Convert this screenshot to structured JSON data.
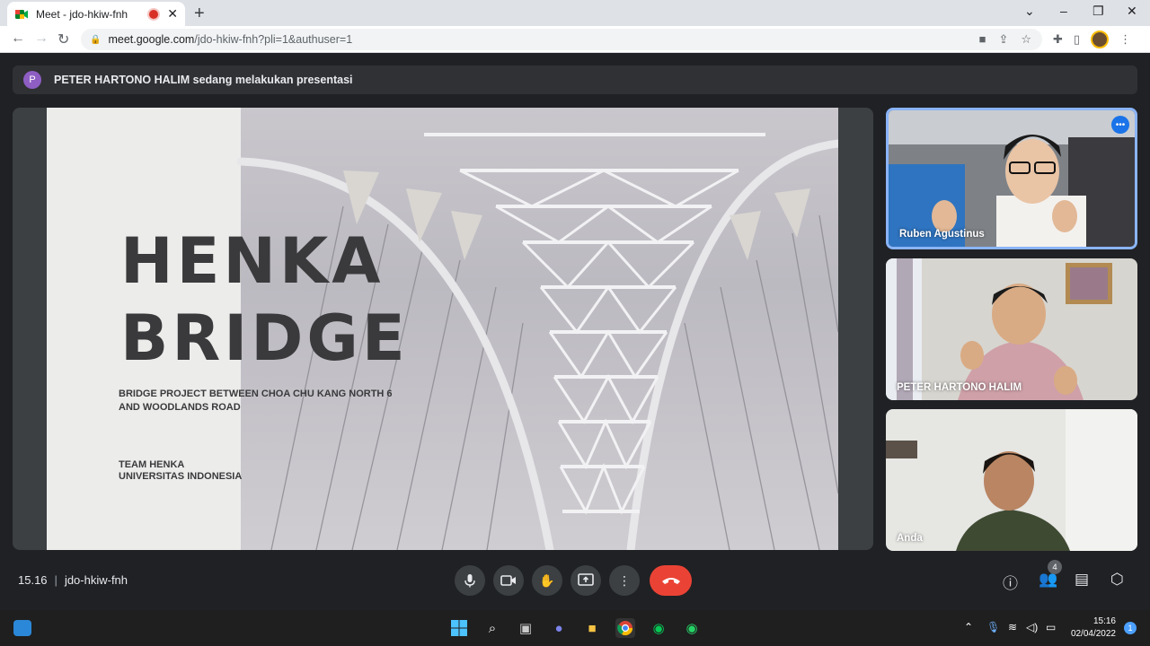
{
  "browser": {
    "tab_title": "Meet - jdo-hkiw-fnh",
    "tab_close": "✕",
    "new_tab": "+",
    "url_host": "meet.google.com",
    "url_path": "/jdo-hkiw-fnh?pli=1&authuser=1",
    "window_controls": [
      "⌄",
      "–",
      "❐",
      "✕"
    ]
  },
  "banner": {
    "avatar_letter": "P",
    "text": "PETER HARTONO HALIM sedang melakukan presentasi"
  },
  "slide": {
    "title_line1": "HENKA",
    "title_line2": "BRIDGE",
    "subtitle_line1": "BRIDGE PROJECT BETWEEN CHOA CHU KANG NORTH 6",
    "subtitle_line2": "AND WOODLANDS ROAD",
    "team_line1": "TEAM HENKA",
    "team_line2": "UNIVERSITAS INDONESIA"
  },
  "participants": [
    {
      "name": "Ruben Agustinus",
      "active": true
    },
    {
      "name": "PETER HARTONO HALIM",
      "active": false
    },
    {
      "name": "Anda",
      "active": false
    }
  ],
  "tile_more": "•••",
  "meeting": {
    "time": "15.16",
    "code": "jdo-hkiw-fnh",
    "people_count": "4"
  },
  "taskbar": {
    "clock_time": "15:16",
    "clock_date": "02/04/2022",
    "notifications": "1"
  },
  "colors": {
    "accent_blue": "#1a73e8",
    "end_call_red": "#ea4335",
    "meet_bg": "#202124"
  }
}
